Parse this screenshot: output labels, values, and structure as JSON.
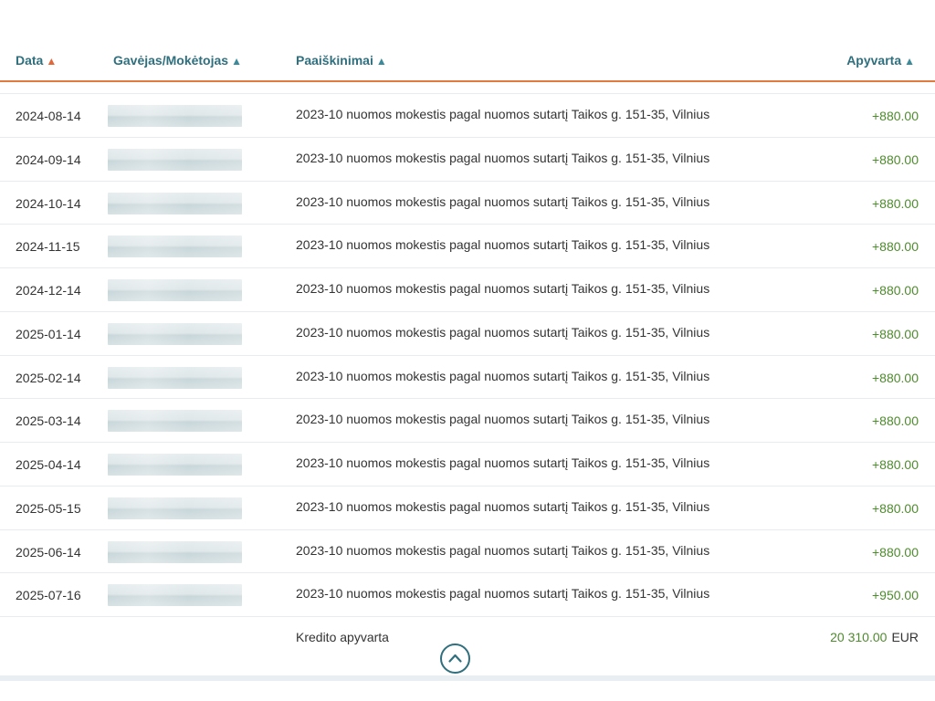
{
  "table": {
    "columns": {
      "date": "Data",
      "payee": "Gavėjas/Mokėtojas",
      "description": "Paaiškinimai",
      "amount": "Apyvarta"
    },
    "sort_arrow": "▲",
    "rows": [
      {
        "date": "2024-08-14",
        "description": "2023-10 nuomos mokestis pagal nuomos sutartį Taikos g. 151-35, Vilnius",
        "amount": "+880.00"
      },
      {
        "date": "2024-09-14",
        "description": "2023-10 nuomos mokestis pagal nuomos sutartį Taikos g. 151-35, Vilnius",
        "amount": "+880.00"
      },
      {
        "date": "2024-10-14",
        "description": "2023-10 nuomos mokestis pagal nuomos sutartį Taikos g. 151-35, Vilnius",
        "amount": "+880.00"
      },
      {
        "date": "2024-11-15",
        "description": "2023-10 nuomos mokestis pagal nuomos sutartį Taikos g. 151-35, Vilnius",
        "amount": "+880.00"
      },
      {
        "date": "2024-12-14",
        "description": "2023-10 nuomos mokestis pagal nuomos sutartį Taikos g. 151-35, Vilnius",
        "amount": "+880.00"
      },
      {
        "date": "2025-01-14",
        "description": "2023-10 nuomos mokestis pagal nuomos sutartį Taikos g. 151-35, Vilnius",
        "amount": "+880.00"
      },
      {
        "date": "2025-02-14",
        "description": "2023-10 nuomos mokestis pagal nuomos sutartį Taikos g. 151-35, Vilnius",
        "amount": "+880.00"
      },
      {
        "date": "2025-03-14",
        "description": "2023-10 nuomos mokestis pagal nuomos sutartį Taikos g. 151-35, Vilnius",
        "amount": "+880.00"
      },
      {
        "date": "2025-04-14",
        "description": "2023-10 nuomos mokestis pagal nuomos sutartį Taikos g. 151-35, Vilnius",
        "amount": "+880.00"
      },
      {
        "date": "2025-05-15",
        "description": "2023-10 nuomos mokestis pagal nuomos sutartį Taikos g. 151-35, Vilnius",
        "amount": "+880.00"
      },
      {
        "date": "2025-06-14",
        "description": "2023-10 nuomos mokestis pagal nuomos sutartį Taikos g. 151-35, Vilnius",
        "amount": "+880.00"
      },
      {
        "date": "2025-07-16",
        "description": "2023-10 nuomos mokestis pagal nuomos sutartį Taikos g. 151-35, Vilnius",
        "amount": "+950.00"
      }
    ],
    "footer": {
      "label": "Kredito apyvarta",
      "total": "20 310.00",
      "currency": "EUR"
    }
  },
  "icons": {
    "sort": "triangle-up-icon",
    "scroll_top": "chevron-up-icon"
  },
  "colors": {
    "header_text": "#2f6f7e",
    "active_sort_arrow": "#e0683a",
    "header_underline": "#e07a3f",
    "credit_amount": "#4f8a2e"
  }
}
